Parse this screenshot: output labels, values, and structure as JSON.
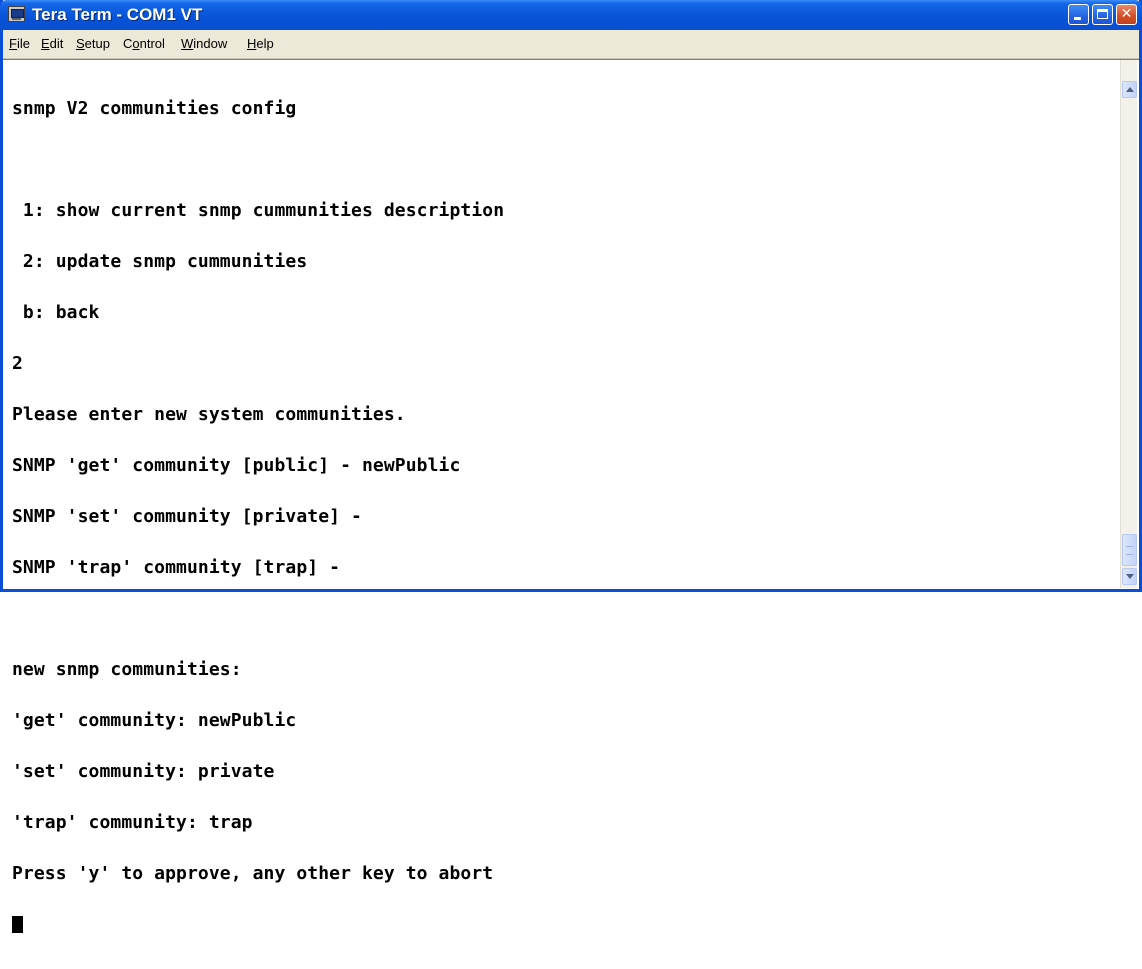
{
  "window": {
    "title": "Tera Term - COM1 VT",
    "icon": "terminal-app-icon"
  },
  "menu": [
    {
      "pre": "",
      "key": "F",
      "post": "ile"
    },
    {
      "pre": "",
      "key": "E",
      "post": "dit"
    },
    {
      "pre": "",
      "key": "S",
      "post": "etup"
    },
    {
      "pre": "C",
      "key": "o",
      "post": "ntrol"
    },
    {
      "pre": "",
      "key": "W",
      "post": "indow"
    },
    {
      "pre": "",
      "key": "H",
      "post": "elp"
    }
  ],
  "terminal": {
    "lines": [
      "snmp V2 communities config",
      "",
      " 1: show current snmp cummunities description",
      " 2: update snmp cummunities",
      " b: back",
      "2",
      "Please enter new system communities.",
      "SNMP 'get' community [public] - newPublic",
      "SNMP 'set' community [private] -",
      "SNMP 'trap' community [trap] -",
      "",
      "new snmp communities:",
      "'get' community: newPublic",
      "'set' community: private",
      "'trap' community: trap",
      "Press 'y' to approve, any other key to abort"
    ]
  },
  "controls": {
    "minimize": "minimize-icon",
    "maximize": "maximize-icon",
    "close": "close-icon"
  }
}
